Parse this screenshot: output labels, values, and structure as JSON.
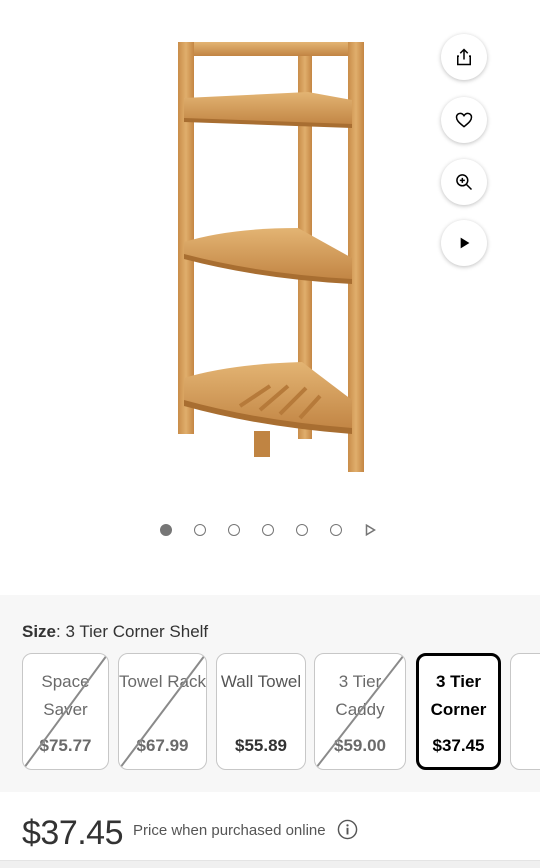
{
  "gallery": {
    "image_alt": "Bamboo 3 tier corner shelf",
    "actions": [
      "share-icon",
      "heart-icon",
      "zoom-in-icon",
      "play-icon"
    ],
    "image_count": 6,
    "active_index": 0
  },
  "size": {
    "label": "Size",
    "selected": "3 Tier Corner Shelf",
    "options": [
      {
        "name": "Space Saver",
        "price": "$75.77",
        "available": false,
        "selected": false
      },
      {
        "name": "Towel Rack",
        "price": "$67.99",
        "available": false,
        "selected": false
      },
      {
        "name": "Wall Towel",
        "price": "$55.89",
        "available": true,
        "selected": false
      },
      {
        "name": "3 Tier Caddy",
        "price": "$59.00",
        "available": false,
        "selected": false
      },
      {
        "name": "3 Tier Corner",
        "price": "$37.45",
        "available": true,
        "selected": true
      }
    ]
  },
  "pricing": {
    "price": "$37.45",
    "note": "Price when purchased online"
  },
  "colors": {
    "wood": "#d9a35f",
    "wood_dark": "#b57f3d",
    "selected_border": "#000000",
    "panel_bg": "#f7f7f7"
  }
}
